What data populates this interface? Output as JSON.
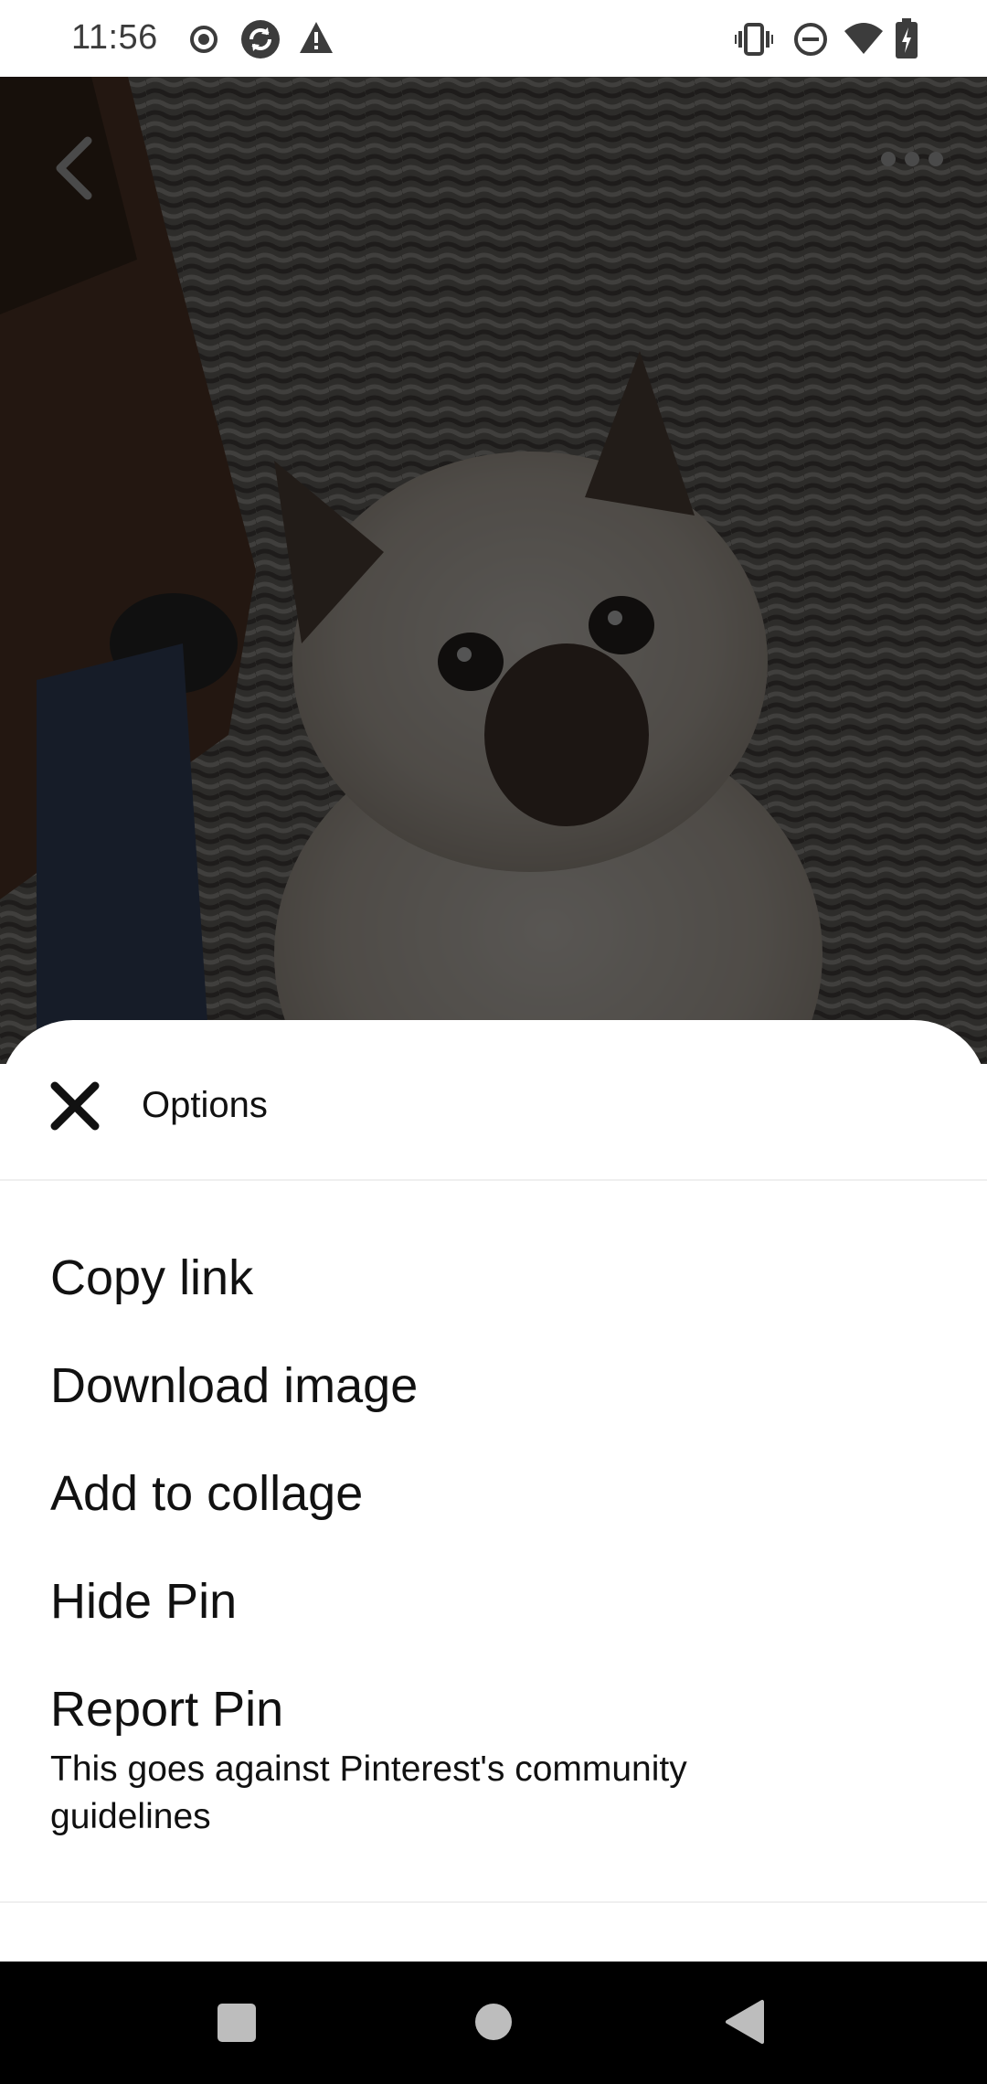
{
  "status_bar": {
    "time": "11:56",
    "left_icons": [
      "record-icon",
      "sync-icon",
      "warning-icon"
    ],
    "right_icons": [
      "vibrate-icon",
      "do-not-disturb-icon",
      "wifi-icon",
      "battery-charging-icon"
    ]
  },
  "pin": {
    "image": "cat-photo",
    "back_icon": "chevron-left-icon",
    "more_icon": "more-horizontal-icon"
  },
  "sheet": {
    "title": "Options",
    "close_icon": "close-icon",
    "options": [
      {
        "label": "Copy link"
      },
      {
        "label": "Download image"
      },
      {
        "label": "Add to collage"
      },
      {
        "label": "Hide Pin"
      },
      {
        "label": "Report Pin",
        "sublabel": "This goes against Pinterest's community guidelines"
      }
    ]
  },
  "nav_bar": {
    "buttons": [
      "recents-button",
      "home-button",
      "back-button"
    ]
  },
  "colors": {
    "sheet_background": "#ffffff",
    "text": "#111111",
    "divider": "#efefef",
    "nav_bar": "#000000",
    "scrim": "#000000"
  }
}
